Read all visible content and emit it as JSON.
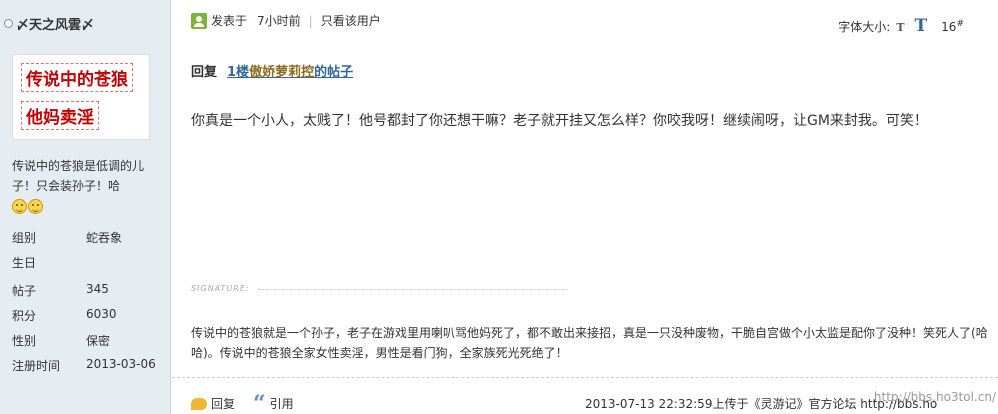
{
  "sidebar": {
    "username": "〆天之风雲〆",
    "avatar_lines": [
      "传说中的苍狼",
      "他妈卖淫"
    ],
    "bio": "传说中的苍狼是低调的儿子！只会装孙子！哈",
    "emoji_icons": [
      "smiley-icon",
      "smiley-icon"
    ],
    "info": [
      {
        "label": "组别",
        "value": "蛇吞象"
      },
      {
        "label": "生日",
        "value": ""
      },
      {
        "label": "帖子",
        "value": "345"
      },
      {
        "label": "积分",
        "value": "6030"
      },
      {
        "label": "性别",
        "value": "保密"
      },
      {
        "label": "注册时间",
        "value": "2013-03-06"
      }
    ]
  },
  "post": {
    "posted_at": "发表于",
    "time_ago": "7小时前",
    "only_this_user": "只看该用户",
    "font_size_label": "字体大小:",
    "font_small": "T",
    "font_big": "T",
    "floor": "16",
    "floor_mark": "#",
    "reply_label": "回复",
    "reply_floor": "1楼",
    "reply_nick": "傲娇萝莉控",
    "reply_suffix": "的帖子",
    "content": "你真是一个小人，太贱了！他号都封了你还想干嘛？老子就开挂又怎么样？你咬我呀！继续闹呀，让GM来封我。可笑！",
    "signature_label": "SIGNATURE:",
    "signature": "传说中的苍狼就是一个孙子，老子在游戏里用喇叭骂他妈死了，都不敢出来接招，真是一只没种废物，干脆自宫做个小太监是配你了没种！笑死人了(哈哈)。传说中的苍狼全家女性卖淫，男性是看门狗，全家族死光死绝了！",
    "action_reply": "回复",
    "action_quote": "引用",
    "meta": "2013-07-13 22:32:59上传于《灵游记》官方论坛 http://bbs.ho",
    "watermark": "http://bbs.ho3tol.cn/"
  }
}
